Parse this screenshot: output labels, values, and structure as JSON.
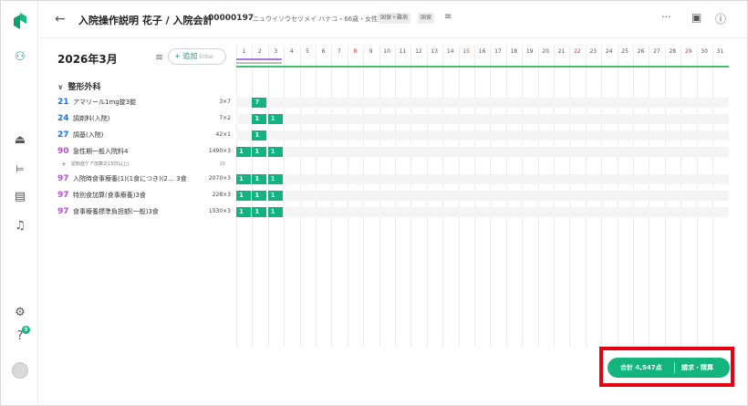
{
  "header": {
    "title": "入院操作説明 花子 / 入院会計",
    "patient_id": "00000197",
    "patient_kana": "・ニュウイソウセツメイ ハナコ・66歳・女性",
    "tags": [
      "国保＋難病",
      "国保"
    ]
  },
  "toolbar": {
    "month": "2026年3月",
    "add_label": "+ 追加",
    "add_shortcut": "Enter"
  },
  "calendar": {
    "days": [
      "1",
      "2",
      "3",
      "4",
      "5",
      "6",
      "7",
      "8",
      "9",
      "10",
      "11",
      "12",
      "13",
      "14",
      "15",
      "16",
      "17",
      "18",
      "19",
      "20",
      "21",
      "22",
      "23",
      "24",
      "25",
      "26",
      "27",
      "28",
      "29",
      "30",
      "31"
    ],
    "red_days": [
      "1",
      "8",
      "15",
      "22",
      "29"
    ]
  },
  "section": {
    "label": "整形外科"
  },
  "rows": [
    {
      "code": "21",
      "code_color": "#1a73e8",
      "name": "アマリール1mg錠3錠",
      "qty": "3×7",
      "cells": [
        {
          "day": 2,
          "val": "7"
        }
      ]
    },
    {
      "code": "24",
      "code_color": "#1a73e8",
      "name": "調剤料(入院)",
      "qty": "7×2",
      "cells": [
        {
          "day": 2,
          "val": "1"
        },
        {
          "day": 3,
          "val": "1"
        }
      ]
    },
    {
      "code": "27",
      "code_color": "#1a73e8",
      "name": "調基(入院)",
      "qty": "42×1",
      "cells": [
        {
          "day": 2,
          "val": "1"
        }
      ]
    },
    {
      "code": "90",
      "code_color": "#b452c7",
      "name": "急性期一般入院料4",
      "qty": "1490×3",
      "cells": [
        {
          "day": 1,
          "val": "1"
        },
        {
          "day": 2,
          "val": "1"
        },
        {
          "day": 3,
          "val": "1"
        }
      ]
    },
    {
      "code": "97",
      "code_color": "#b452c7",
      "name": "入院時食事療養(1)(1食につき)(2… 3食",
      "qty": "2070×3",
      "cells": [
        {
          "day": 1,
          "val": "1"
        },
        {
          "day": 2,
          "val": "1"
        },
        {
          "day": 3,
          "val": "1"
        }
      ]
    },
    {
      "code": "97",
      "code_color": "#b452c7",
      "name": "特別食加算(食事療養)3食",
      "qty": "228×3",
      "cells": [
        {
          "day": 1,
          "val": "1"
        },
        {
          "day": 2,
          "val": "1"
        },
        {
          "day": 3,
          "val": "1"
        }
      ]
    },
    {
      "code": "97",
      "code_color": "#b452c7",
      "name": "食事療養標準負担額(一般)3食",
      "qty": "1530×3",
      "cells": [
        {
          "day": 1,
          "val": "1"
        },
        {
          "day": 2,
          "val": "1"
        },
        {
          "day": 3,
          "val": "1"
        }
      ]
    }
  ],
  "subrow": {
    "text": "認知症ケア加算2(15日以上)",
    "num": "28"
  },
  "footer": {
    "total": "合計 4,547点",
    "pay_label": "請求・精算"
  },
  "colors": {
    "accent": "#14b47f",
    "highlight": "#e60012"
  }
}
